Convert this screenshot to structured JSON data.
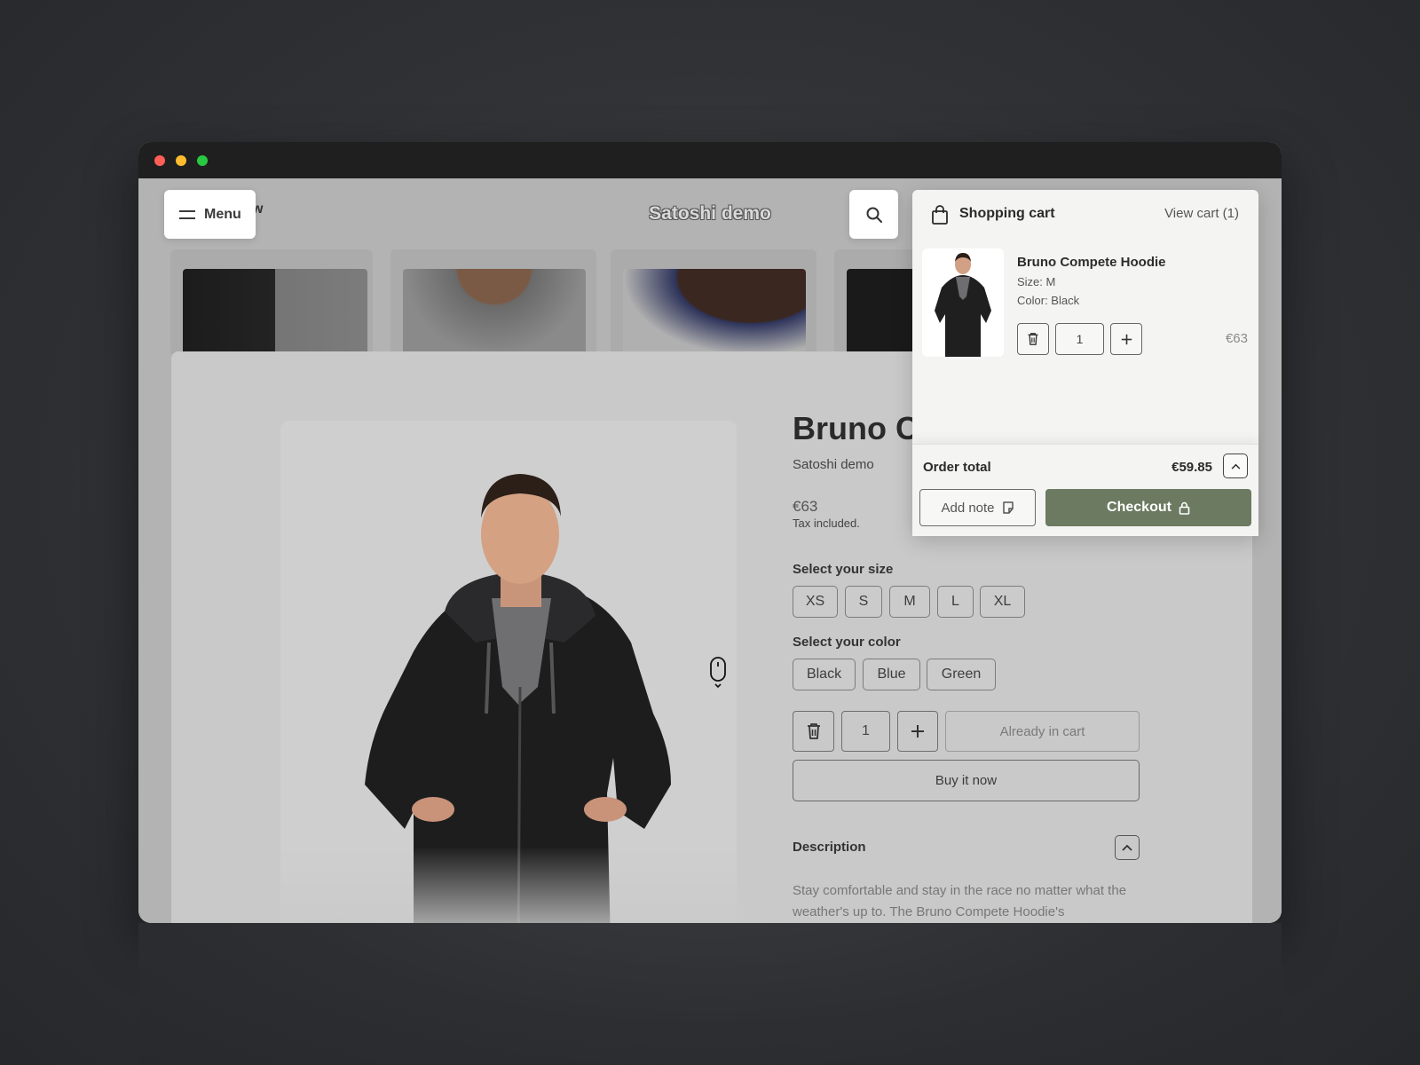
{
  "colors": {
    "accent": "#6c7a61",
    "window_chrome": "#1f1f1f",
    "traffic_red": "#ff5f57",
    "traffic_yellow": "#febc2e",
    "traffic_green": "#28c840"
  },
  "header": {
    "menu_label": "Menu",
    "behind_text": "w",
    "store_title": "Satoshi demo"
  },
  "product": {
    "title": "Bruno Co",
    "vendor": "Satoshi demo",
    "price": "€63",
    "tax_note": "Tax included.",
    "size_label": "Select your size",
    "sizes": [
      "XS",
      "S",
      "M",
      "L",
      "XL"
    ],
    "color_label": "Select your color",
    "colors": [
      "Black",
      "Blue",
      "Green"
    ],
    "quantity": "1",
    "already_in_cart": "Already in cart",
    "buy_now": "Buy it now",
    "description_label": "Description",
    "description_text": "Stay comfortable and stay in the race no matter what the weather's up to. The Bruno Compete Hoodie's"
  },
  "cart": {
    "title": "Shopping cart",
    "view_cart": "View cart (1)",
    "item": {
      "name": "Bruno Compete Hoodie",
      "size": "Size: M",
      "color": "Color: Black",
      "quantity": "1",
      "price": "€63"
    },
    "order_total_label": "Order total",
    "order_total_value": "€59.85",
    "add_note": "Add note",
    "checkout": "Checkout"
  }
}
